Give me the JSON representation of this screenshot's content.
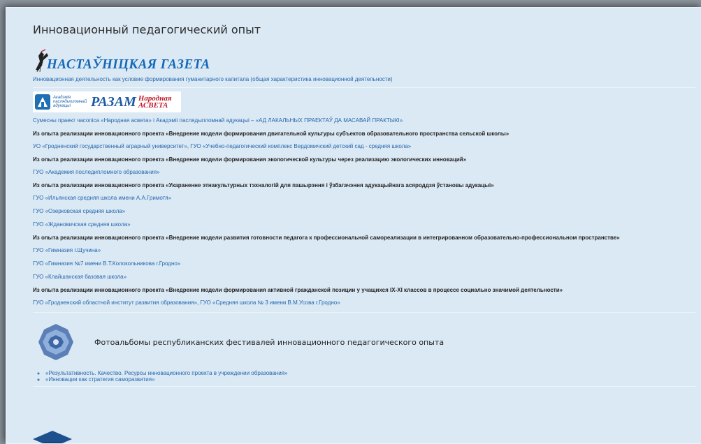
{
  "page": {
    "title": "Инновационный педагогический опыт"
  },
  "logos": {
    "ng_word": "НАСТАЎНІЦКАЯ ГАЗЕТА",
    "akad_text": "Акадэмія паслядыпломнай адукацыі",
    "razam": "РАЗАМ",
    "narodnaya_line1": "Народная",
    "narodnaya_line2": "АСВЕТА"
  },
  "first_link": "Инновационная деятельность как условие формирования гуманитарного капитала (общая характеристика инновационной деятельности)",
  "items": [
    {
      "type": "link",
      "text": "Сумесны праект часопіса «Народная асвета» і Акадэміі паслядыпломнай адукацыі – «АД ЛАКАЛЬНЫХ ПРАЕКТАЎ ДА МАСАВАЙ ПРАКТЫКІ»"
    },
    {
      "type": "bold",
      "text": "Из опыта реализации инновационного проекта «Внедрение модели формирования двигательной культуры субъектов образовательного пространства сельской школы»"
    },
    {
      "type": "link",
      "text": "УО «Гродненский государственный аграрный университет», ГУО «Учебно-педагогический комплекс Вердомичский детский сад - средняя школа»"
    },
    {
      "type": "bold",
      "text": "Из опыта реализации инновационного проекта «Внедрение модели формирования экологической культуры через реализацию экологических инноваций»"
    },
    {
      "type": "link",
      "text": "ГУО «Академия последипломного образования»"
    },
    {
      "type": "bold",
      "text": "Из опыта реализации инновационного проекта  «Укараненне этнакультурных тэхналогій для пашырэння і ўзбагачэння адукацыйнага асяроддзя ўстановы адукацыі»"
    },
    {
      "type": "link",
      "text": "ГУО «Ильянская средняя школа имени А.А.Гримотя»"
    },
    {
      "type": "link",
      "text": "ГУО «Озерковская средняя школа»"
    },
    {
      "type": "link",
      "text": "ГУО «Ждановичская средняя школа»"
    },
    {
      "type": "bold",
      "text": "Из опыта реализации инновационного проекта  «Внедрение модели развития готовности педагога к профессиональной самореализации в интегрированном образовательно-профессиональном пространстве»"
    },
    {
      "type": "link",
      "text": "ГУО «Гимназия г.Щучина»"
    },
    {
      "type": "link",
      "text": "ГУО «Гимназия №7 имени В.Т.Колокольникова г.Гродно»"
    },
    {
      "type": "link",
      "text": "ГУО «Клайшанская базовая школа»"
    },
    {
      "type": "bold",
      "text": "Из опыта реализации инновационного проекта  «Внедрение модели формирования активной гражданской позиции у учащихся IX-XI классов в процессе социально значимой деятельности»"
    },
    {
      "type": "link",
      "text": "ГУО «Гродненский областной институт развития образования», ГУО «Средняя школа № 3 имени В.М.Усова г.Гродно»"
    }
  ],
  "photo": {
    "title": "Фотоальбомы республиканских фестивалей инновационного педагогического опыта",
    "links": [
      "«Результативность. Качество. Ресурсы инновационного проекта в учреждении образования»",
      "«Инновации как стратегия саморазвития»"
    ]
  },
  "colors": {
    "panel_bg": "#dbe9f4",
    "link": "#2566ad",
    "heading": "#2b2b2b"
  },
  "icons": [
    "stork-icon",
    "academy-icon",
    "emblem-icon",
    "graduation-cap-icon"
  ]
}
